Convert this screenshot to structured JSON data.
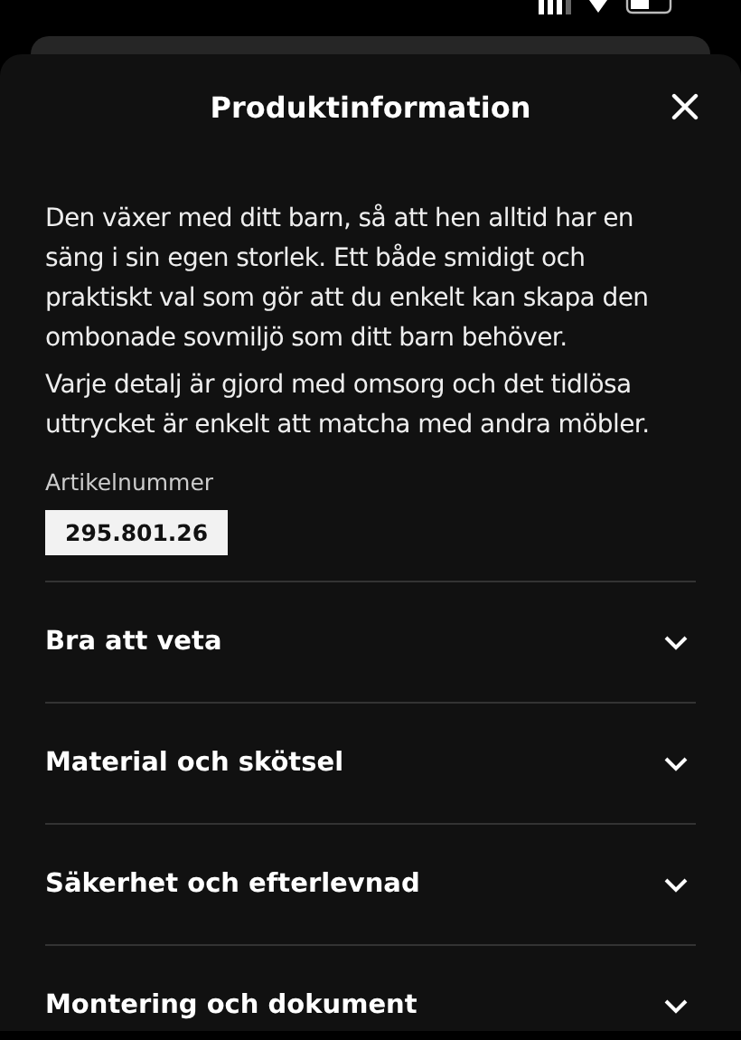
{
  "sheet": {
    "title": "Produktinformation"
  },
  "description": [
    "Den växer med ditt barn, så att hen alltid har en säng i sin egen storlek. Ett både smidigt och praktiskt val som gör att du enkelt kan skapa den ombonade sovmiljö som ditt barn behöver.",
    "Varje detalj är gjord med omsorg och det tidlösa uttrycket är enkelt att matcha med andra möbler."
  ],
  "article": {
    "label": "Artikelnummer",
    "number": "295.801.26"
  },
  "sections": [
    {
      "title": "Bra att veta",
      "expanded": false
    },
    {
      "title": "Material och skötsel",
      "expanded": false
    },
    {
      "title": "Säkerhet och efterlevnad",
      "expanded": false
    },
    {
      "title": "Montering och dokument",
      "expanded": false
    }
  ]
}
